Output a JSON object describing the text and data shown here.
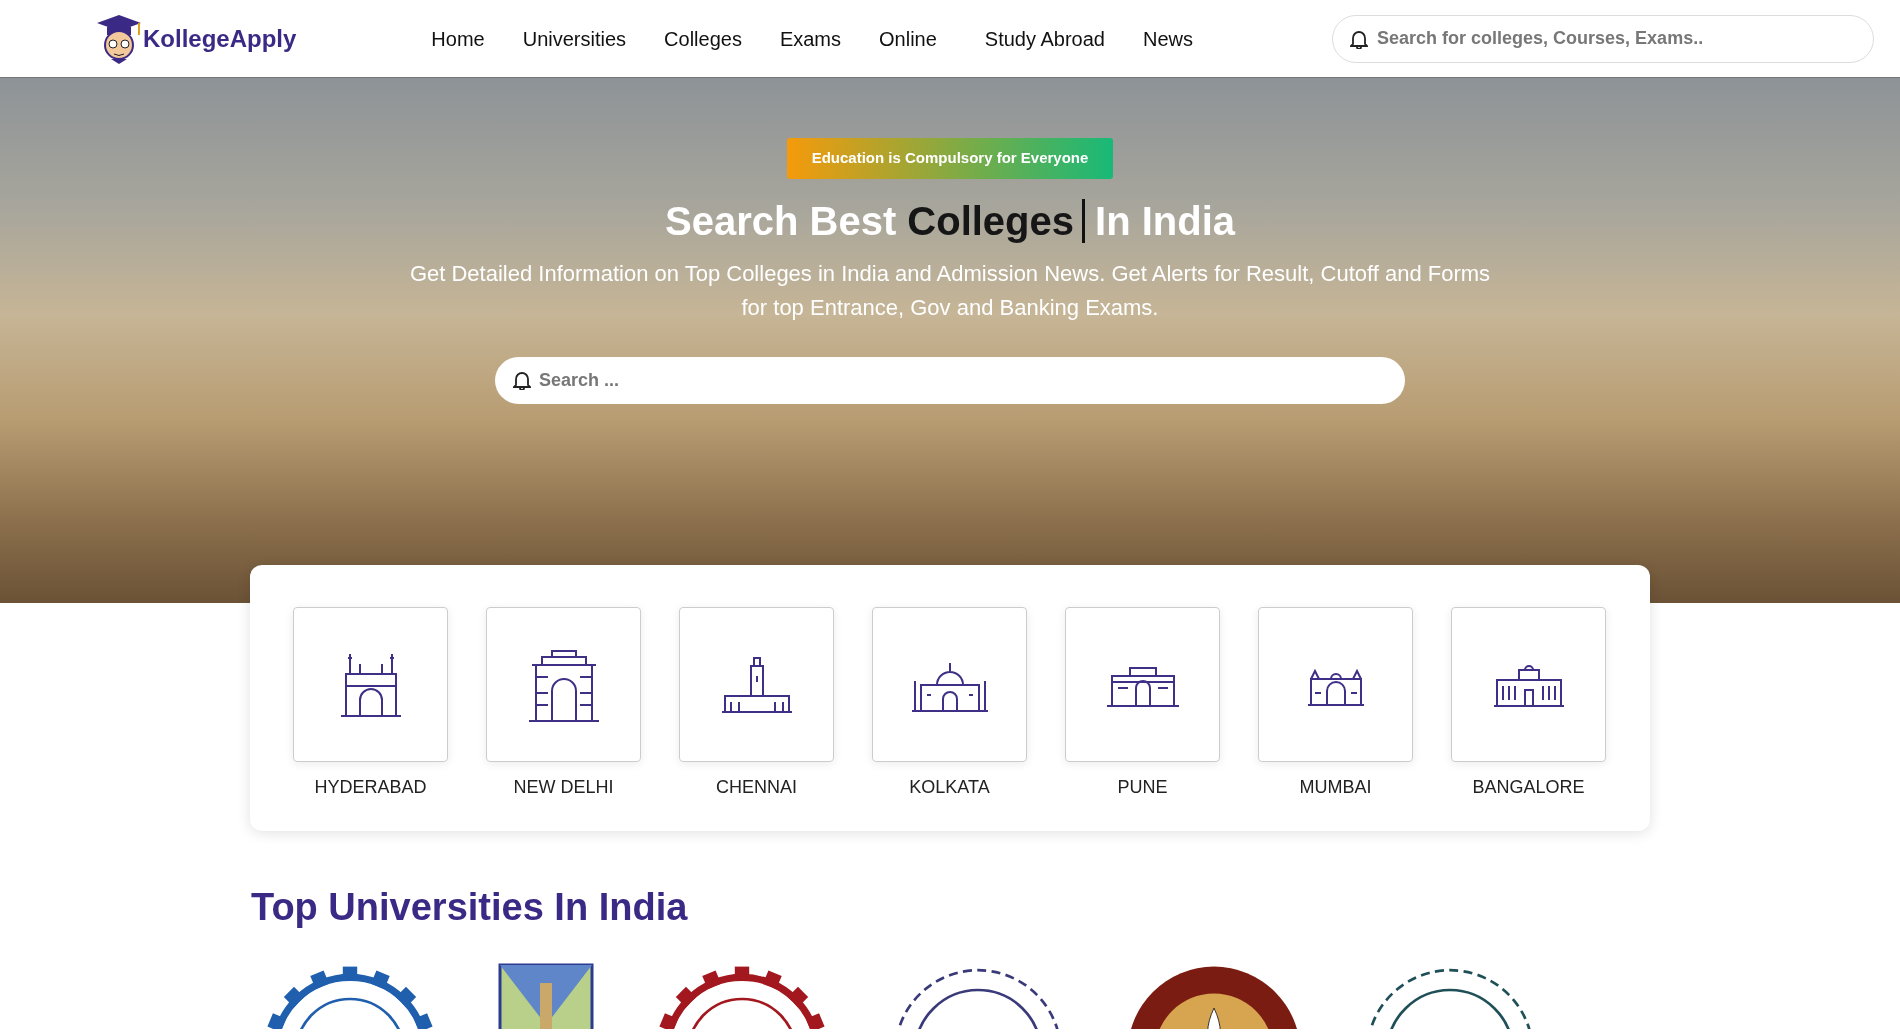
{
  "header": {
    "brand": "KollegeApply",
    "nav": [
      {
        "label": "Home"
      },
      {
        "label": "Universities"
      },
      {
        "label": "Colleges"
      },
      {
        "label": "Exams"
      },
      {
        "label": "Online"
      },
      {
        "label": "Study Abroad"
      },
      {
        "label": "News"
      }
    ],
    "search": {
      "placeholder": "Search for colleges, Courses, Exams.."
    }
  },
  "hero": {
    "badge": "Education is Compulsory for Everyone",
    "title_before": "Search Best ",
    "title_typed": "Colleges",
    "title_after": "In India",
    "subtitle": "Get Detailed Information on Top Colleges in India and Admission News. Get Alerts for Result, Cutoff and Forms for top Entrance, Gov and Banking Exams.",
    "search": {
      "placeholder": "Search ..."
    }
  },
  "cities": [
    {
      "name": "HYDERABAD",
      "kind": "minaret"
    },
    {
      "name": "NEW DELHI",
      "kind": "gate"
    },
    {
      "name": "CHENNAI",
      "kind": "tower"
    },
    {
      "name": "KOLKATA",
      "kind": "dome"
    },
    {
      "name": "PUNE",
      "kind": "fort"
    },
    {
      "name": "MUMBAI",
      "kind": "arch"
    },
    {
      "name": "BANGALORE",
      "kind": "hall"
    }
  ],
  "universities": {
    "title": "Top Universities In India",
    "logos": [
      {
        "kind": "gear",
        "color": "#1f5fae"
      },
      {
        "kind": "crest",
        "color": "#5e86c8"
      },
      {
        "kind": "gear",
        "color": "#a3171e"
      },
      {
        "kind": "cog",
        "color": "#3a3a7a"
      },
      {
        "kind": "seal",
        "color": "#7a1c12"
      },
      {
        "kind": "cog",
        "color": "#1f4f57"
      }
    ]
  }
}
